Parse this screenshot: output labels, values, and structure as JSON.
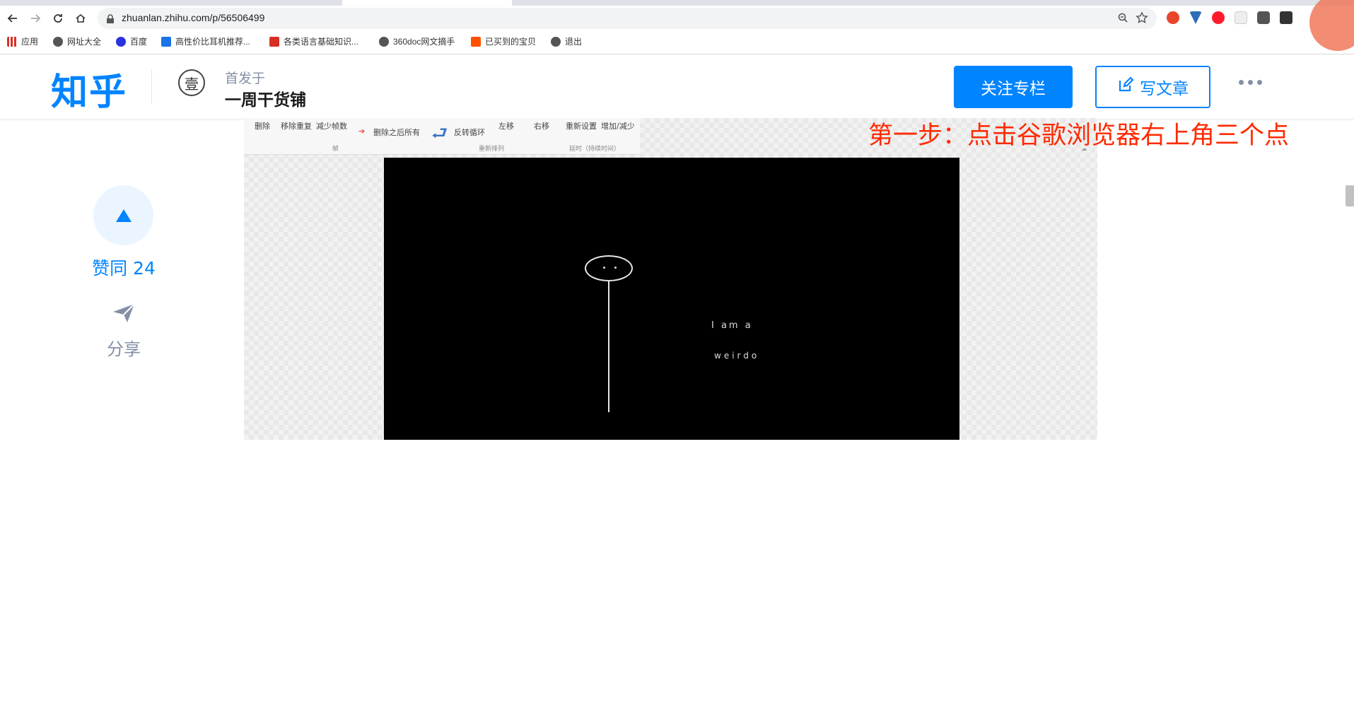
{
  "browser": {
    "url": "zhuanlan.zhihu.com/p/56506499",
    "bookmarks": [
      "应用",
      "网址大全",
      "百度",
      "高性价比耳机推荐...",
      "各类语言基础知识...",
      "360doc网文摘手",
      "已买到的宝贝",
      "退出"
    ]
  },
  "header": {
    "logo": "知乎",
    "column_avatar_char": "壹",
    "first_published": "首发于",
    "column_name": "一周干货铺",
    "follow_button": "关注专栏",
    "write_button": "写文章"
  },
  "sidebar": {
    "vote_label": "赞同 24",
    "share_label": "分享"
  },
  "article": {
    "ribbon": {
      "items": [
        "删除",
        "移除重复",
        "减少帧数",
        "删除之后所有",
        "反转循环",
        "左移",
        "右移",
        "重新设置",
        "增加/减少"
      ],
      "groups": [
        "帧",
        "重新排列",
        "延时（持续时间）"
      ]
    },
    "video_caption_line1": "I am a",
    "video_caption_line2": "weirdo",
    "annotation": "第一步：点击谷歌浏览器右上角三个点"
  },
  "colors": {
    "brand": "#0084ff",
    "annotation": "#ff2a00"
  }
}
